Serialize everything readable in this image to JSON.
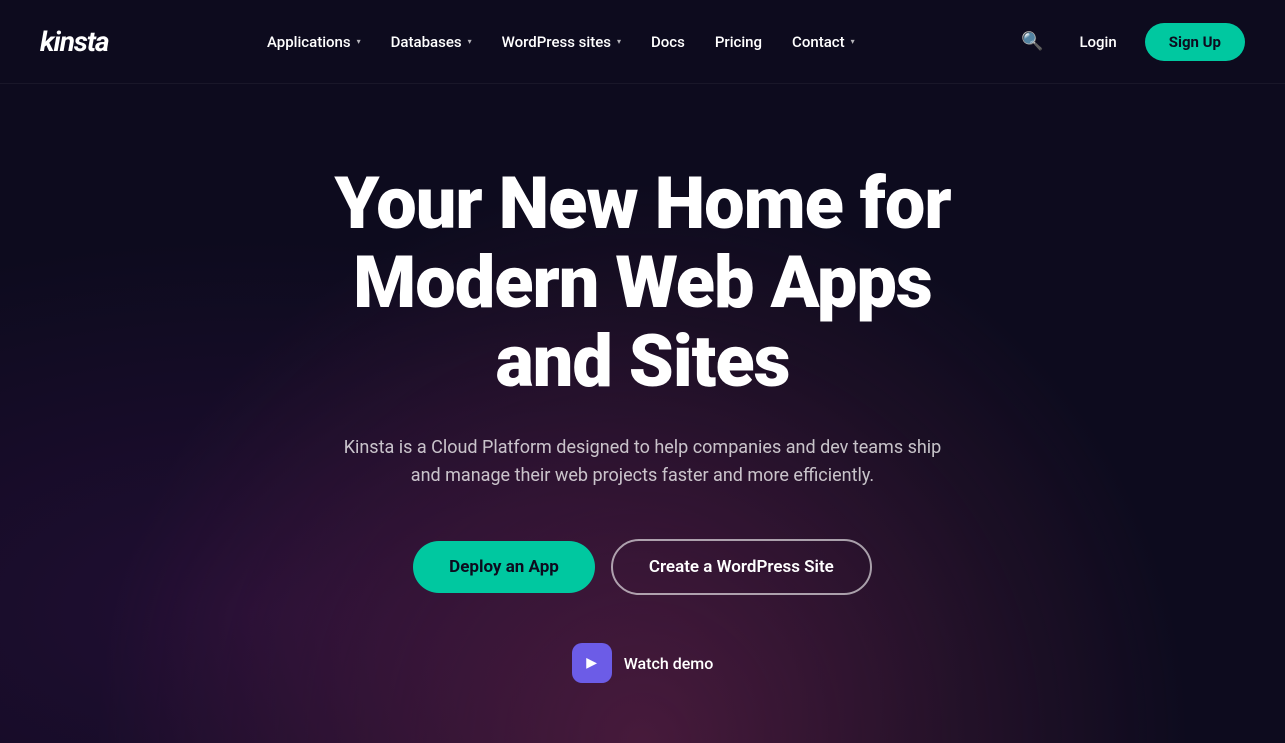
{
  "logo": {
    "text": "kinsta"
  },
  "nav": {
    "links": [
      {
        "label": "Applications",
        "has_dropdown": true
      },
      {
        "label": "Databases",
        "has_dropdown": true
      },
      {
        "label": "WordPress sites",
        "has_dropdown": true
      },
      {
        "label": "Docs",
        "has_dropdown": false
      },
      {
        "label": "Pricing",
        "has_dropdown": false
      },
      {
        "label": "Contact",
        "has_dropdown": true
      }
    ],
    "login_label": "Login",
    "signup_label": "Sign Up"
  },
  "hero": {
    "title": "Your New Home for Modern Web Apps and Sites",
    "subtitle": "Kinsta is a Cloud Platform designed to help companies and dev teams ship and manage their web projects faster and more efficiently.",
    "btn_primary": "Deploy an App",
    "btn_secondary": "Create a WordPress Site",
    "watch_demo": "Watch demo"
  },
  "icons": {
    "search": "🔍",
    "chevron": "▾",
    "play": "▶"
  },
  "colors": {
    "accent": "#00c8a0",
    "bg": "#0d0b1e",
    "play_bg": "#6c5ce7"
  }
}
